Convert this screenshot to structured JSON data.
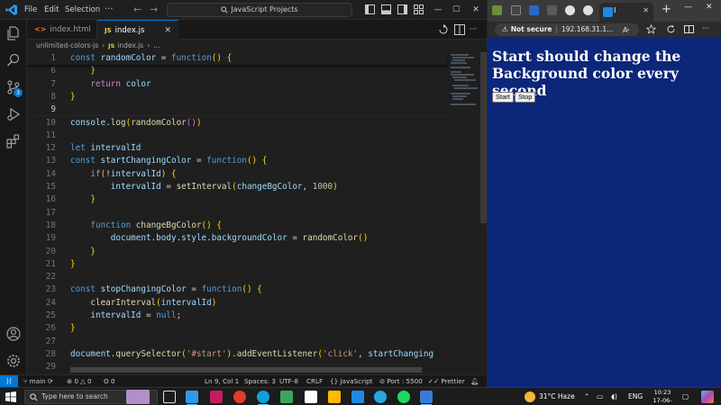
{
  "vscode": {
    "menu": {
      "file": "File",
      "edit": "Edit",
      "selection": "Selection",
      "more": "···"
    },
    "command_center": "JavaScript Projects",
    "tabs": [
      {
        "label": "index.html",
        "icon": "html-file-icon"
      },
      {
        "label": "index.js",
        "icon": "js-file-icon",
        "active": true
      }
    ],
    "breadcrumb": {
      "folder": "unlimited-colors-js",
      "file": "index.js",
      "symbol": "..."
    },
    "scm_badge": "3",
    "code_lines": [
      {
        "n": "1",
        "t": "const randomColor = function() {"
      },
      {
        "n": "6",
        "t": "    }"
      },
      {
        "n": "7",
        "t": "    return color"
      },
      {
        "n": "8",
        "t": "}"
      },
      {
        "n": "9",
        "t": ""
      },
      {
        "n": "10",
        "t": "console.log(randomColor())"
      },
      {
        "n": "11",
        "t": ""
      },
      {
        "n": "12",
        "t": "let intervalId"
      },
      {
        "n": "13",
        "t": "const startChangingColor = function() {"
      },
      {
        "n": "14",
        "t": "    if(!intervalId) {"
      },
      {
        "n": "15",
        "t": "        intervalId = setInterval(changeBgColor, 1000)"
      },
      {
        "n": "16",
        "t": "    }"
      },
      {
        "n": "17",
        "t": ""
      },
      {
        "n": "18",
        "t": "    function changeBgColor() {"
      },
      {
        "n": "19",
        "t": "        document.body.style.backgroundColor = randomColor()"
      },
      {
        "n": "20",
        "t": "    }"
      },
      {
        "n": "21",
        "t": "}"
      },
      {
        "n": "22",
        "t": ""
      },
      {
        "n": "23",
        "t": "const stopChangingColor = function() {"
      },
      {
        "n": "24",
        "t": "    clearInterval(intervalId)"
      },
      {
        "n": "25",
        "t": "    intervalId = null;"
      },
      {
        "n": "26",
        "t": "}"
      },
      {
        "n": "27",
        "t": ""
      },
      {
        "n": "28",
        "t": "document.querySelector('#start').addEventListener('click', startChanging"
      },
      {
        "n": "29",
        "t": ""
      }
    ],
    "status": {
      "branch": "main",
      "errors": "0",
      "warnings": "0",
      "ports": "0",
      "position": "Ln 9, Col 1",
      "spaces": "Spaces: 3",
      "encoding": "UTF-8",
      "eol": "CRLF",
      "language": "JavaScript",
      "live_port": "Port : 5500",
      "formatter": "Prettier"
    }
  },
  "browser": {
    "tab_title": "I",
    "security": "Not secure",
    "url": "192.168.31.1...",
    "background": "#0c267a",
    "heading": "Start should change the Background color every second",
    "buttons": {
      "start": "Start",
      "stop": "Stop"
    }
  },
  "taskbar": {
    "search_placeholder": "Type here to search",
    "weather": "31°C  Haze",
    "language": "ENG",
    "time": "10:23",
    "date": "17-06-2024"
  }
}
